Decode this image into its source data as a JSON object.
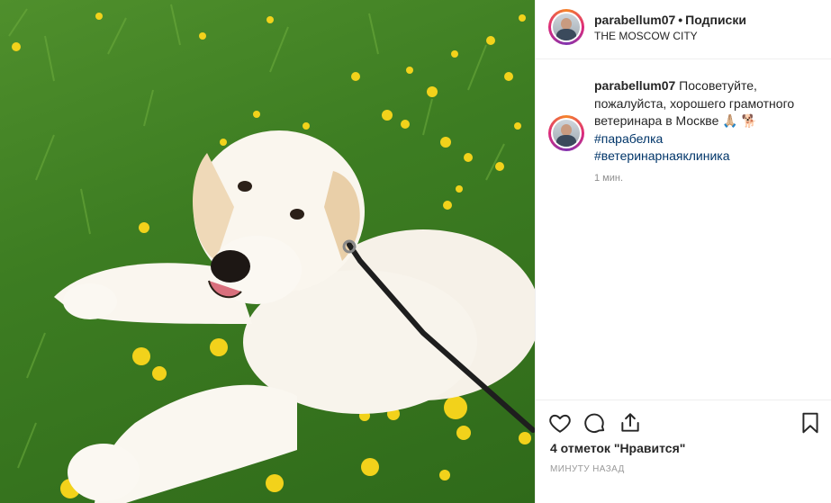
{
  "post": {
    "photo_alt": "",
    "header": {
      "username": "parabellum07",
      "separator": "•",
      "follow_status": "Подписки",
      "location": "THE MOSCOW CITY"
    },
    "caption": {
      "username": "parabellum07",
      "text": "Посоветуйте, пожалуйста, хорошего грамотного ветеринара в Москве 🙏🏼 🐕",
      "hashtags": [
        "#парабелка",
        "#ветеринарнаяклиника"
      ],
      "time": "1 мин."
    },
    "actions": {
      "icons": [
        "heart-icon",
        "comment-icon",
        "share-icon",
        "bookmark-icon"
      ],
      "likes": "4 отметок \"Нравится\"",
      "posted_ago": "МИНУТУ НАЗАД"
    },
    "colors": {
      "link": "#003569",
      "muted": "#8e8e8e",
      "border": "#efefef"
    }
  }
}
